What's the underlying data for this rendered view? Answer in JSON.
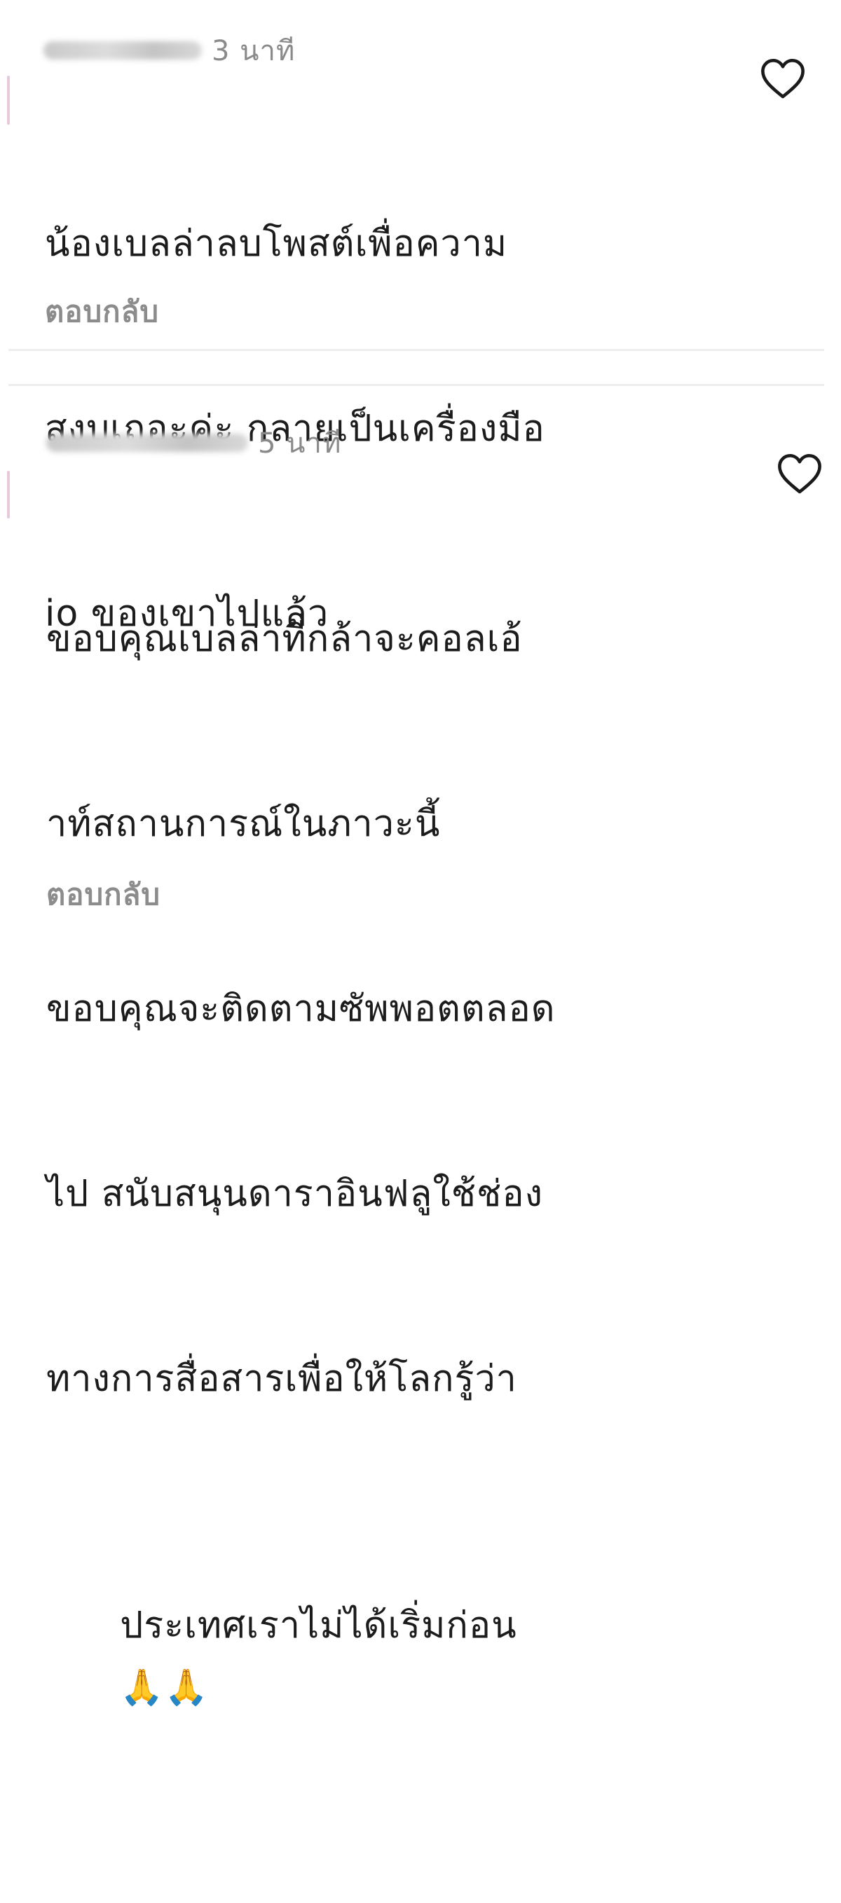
{
  "comments": [
    {
      "username": "",
      "time": "3 นาที",
      "lines": [
        "น้องเบลล่าลบโพสต์เพื่อความ",
        "สงบเถอะค่ะ กลายเป็นเครื่องมือ",
        "io ของเขาไปแล้ว"
      ],
      "reply_label": "ตอบกลับ",
      "like_icon": "heart-outline-icon"
    },
    {
      "username": "",
      "time": "5 นาที",
      "lines": [
        "ขอบคุณเบลล่าที่กล้าจะคอลเอ้",
        "าท์สถานการณ์ในภาวะนี้",
        "ขอบคุณจะติดตามซัพพอตตลอด",
        "ไป สนับสนุนดาราอินฟลูใช้ช่อง",
        "ทางการสื่อสารเพื่อให้โลกรู้ว่า",
        "ประเทศเราไม่ได้เริ่มก่อน"
      ],
      "emojis": "🙏🙏",
      "reply_label": "ตอบกลับ",
      "like_icon": "heart-outline-icon"
    }
  ]
}
